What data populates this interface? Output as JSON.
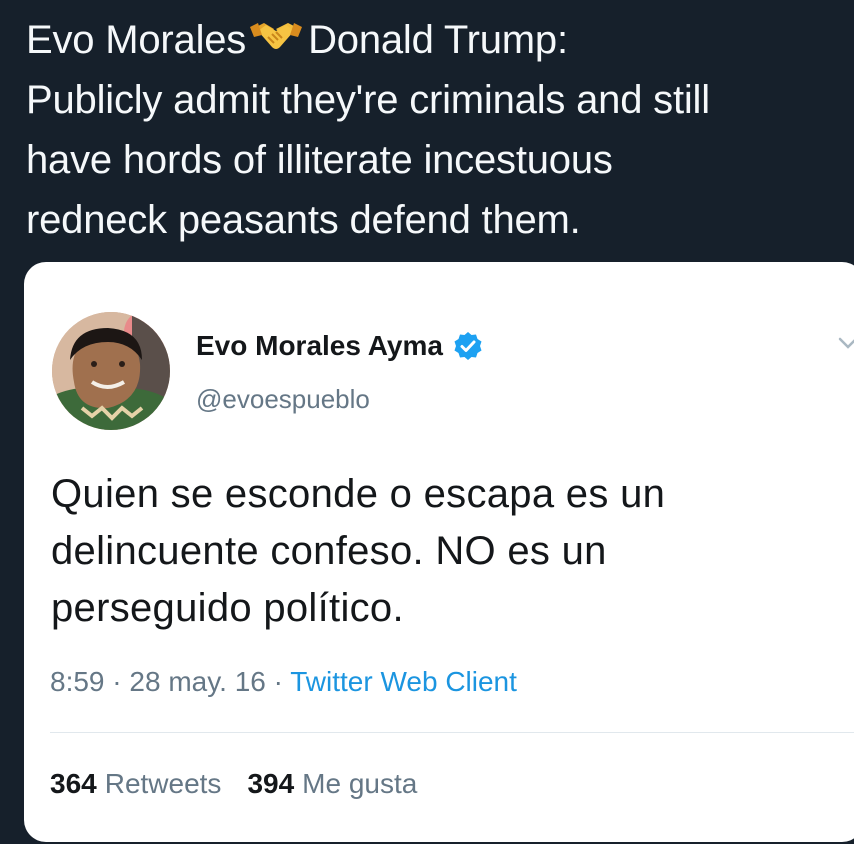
{
  "caption": {
    "line1_left": "Evo Morales",
    "line1_icon": "handshake-icon",
    "line1_right": "Donald Trump:",
    "line2": "Publicly admit they're criminals and still",
    "line3": "have hords of illiterate incestuous",
    "line4": "redneck peasants defend them."
  },
  "tweet": {
    "author_name": "Evo Morales Ayma",
    "verified_icon": "verified-badge-icon",
    "handle": "@evoespueblo",
    "menu_icon": "chevron-down-icon",
    "text_lines": [
      "Quien se esconde o escapa es un",
      "delincuente confeso. NO es un",
      "perseguido político."
    ],
    "time": "8:59",
    "date": "28 may. 16",
    "client": "Twitter Web Client",
    "separator": " · ",
    "retweets_count": "364",
    "retweets_label": "Retweets",
    "likes_count": "394",
    "likes_label": "Me gusta"
  },
  "colors": {
    "background": "#16202b",
    "card": "#ffffff",
    "link": "#1b95e0",
    "secondary_text": "#657786",
    "verified": "#1da1f2"
  }
}
